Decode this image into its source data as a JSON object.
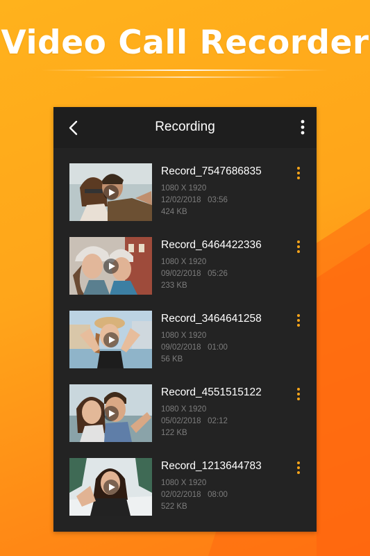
{
  "promo": {
    "title": "Video Call Recorder"
  },
  "colors": {
    "accent": "#f7a41a",
    "panel": "#232323",
    "appbar": "#1e1e1e"
  },
  "appbar": {
    "back_icon": "chevron-left-icon",
    "title": "Recording",
    "menu_icon": "kebab-menu-icon"
  },
  "recordings": [
    {
      "name": "Record_7547686835",
      "resolution": "1080 X 1920",
      "date": "12/02/2018",
      "duration": "03:56",
      "size": "424 KB"
    },
    {
      "name": "Record_6464422336",
      "resolution": "1080 X 1920",
      "date": "09/02/2018",
      "duration": "05:26",
      "size": "233 KB"
    },
    {
      "name": "Record_3464641258",
      "resolution": "1080 X 1920",
      "date": "09/02/2018",
      "duration": "01:00",
      "size": "56 KB"
    },
    {
      "name": "Record_4551515122",
      "resolution": "1080 X 1920",
      "date": "05/02/2018",
      "duration": "02:12",
      "size": "122 KB"
    },
    {
      "name": "Record_1213644783",
      "resolution": "1080 X 1920",
      "date": "02/02/2018",
      "duration": "08:00",
      "size": "522 KB"
    }
  ]
}
